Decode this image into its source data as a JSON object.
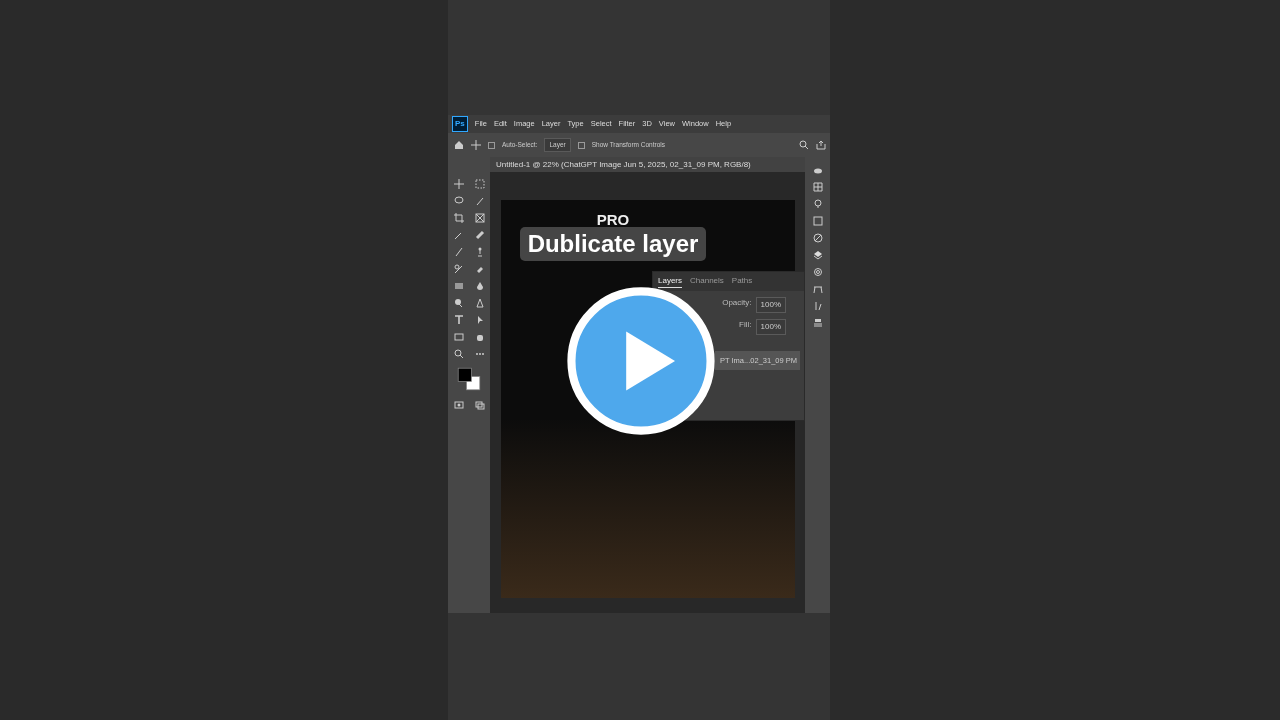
{
  "menu": [
    "File",
    "Edit",
    "Image",
    "Layer",
    "Type",
    "Select",
    "Filter",
    "3D",
    "View",
    "Window",
    "Help"
  ],
  "app_badge": "Ps",
  "options_bar": {
    "auto_select_label": "Auto-Select:",
    "auto_select_checked": false,
    "target": "Layer",
    "transform_label": "Show Transform Controls",
    "transform_checked": false
  },
  "document": {
    "title": "Untitled-1 @ 22% (ChatGPT Image Jun 5, 2025, 02_31_09 PM, RGB/8)"
  },
  "overlay": {
    "brand": "PRO",
    "caption": "Dublicate layer"
  },
  "layers_panel": {
    "tabs": [
      {
        "label": "Layers",
        "selected": true
      },
      {
        "label": "Channels",
        "selected": false
      },
      {
        "label": "Paths",
        "selected": false
      }
    ],
    "opacity_label": "Opacity:",
    "opacity_value": "100%",
    "fill_label": "Fill:",
    "fill_value": "100%",
    "layers": [
      {
        "name": "PT Ima...02_31_09 PM",
        "selected": true
      }
    ]
  }
}
